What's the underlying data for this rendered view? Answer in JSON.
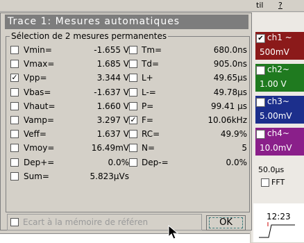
{
  "background_app": {
    "menu_items": [
      "til",
      "?"
    ],
    "channels": [
      {
        "name": "ch1 ~",
        "volt": "500mV",
        "color": "#8b1a1a",
        "checked": true
      },
      {
        "name": "ch2~",
        "volt": "1.00 V",
        "color": "#1f7a1f",
        "checked": false
      },
      {
        "name": "ch3~",
        "volt": "5.00mV",
        "color": "#1c2f8c",
        "checked": false
      },
      {
        "name": "ch4~",
        "volt": "10.0mV",
        "color": "#8a1f8a",
        "checked": false
      }
    ],
    "timebase": "50.0μs",
    "fft_label": "FFT",
    "clock": "12:23"
  },
  "dialog": {
    "title": "Trace 1: Mesures automatiques",
    "group_label": "Sélection de 2 mesures permanentes",
    "left_measures": [
      {
        "label": "Vmin=",
        "value": "-1.655 V",
        "checked": false
      },
      {
        "label": "Vmax=",
        "value": "1.685 V",
        "checked": false
      },
      {
        "label": "Vpp=",
        "value": "3.344 V",
        "checked": true
      },
      {
        "label": "Vbas=",
        "value": "-1.637 V",
        "checked": false
      },
      {
        "label": "Vhaut=",
        "value": "1.660 V",
        "checked": false
      },
      {
        "label": "Vamp=",
        "value": "3.297 V",
        "checked": false
      },
      {
        "label": "Veff=",
        "value": "1.637 V",
        "checked": false
      },
      {
        "label": "Vmoy=",
        "value": "16.49mV",
        "checked": false
      },
      {
        "label": "Dep+=",
        "value": "0.0%",
        "checked": false
      },
      {
        "label": "Sum=",
        "value": "5.823μVs",
        "checked": false
      }
    ],
    "right_measures": [
      {
        "label": "Tm=",
        "value": "680.0ns",
        "checked": false
      },
      {
        "label": "Td=",
        "value": "905.0ns",
        "checked": false
      },
      {
        "label": "L+",
        "value": "49.65μs",
        "checked": false
      },
      {
        "label": "L-=",
        "value": "49.78μs",
        "checked": false
      },
      {
        "label": "P=",
        "value": "99.41 μs",
        "checked": false
      },
      {
        "label": "F=",
        "value": "10.06kHz",
        "checked": true
      },
      {
        "label": "RC=",
        "value": "49.9%",
        "checked": false
      },
      {
        "label": "N=",
        "value": "5",
        "checked": false
      },
      {
        "label": "Dep-=",
        "value": "0.0%",
        "checked": false
      }
    ],
    "reference_label": "Ecart à la mémoire de référen",
    "ok_label": "OK"
  }
}
